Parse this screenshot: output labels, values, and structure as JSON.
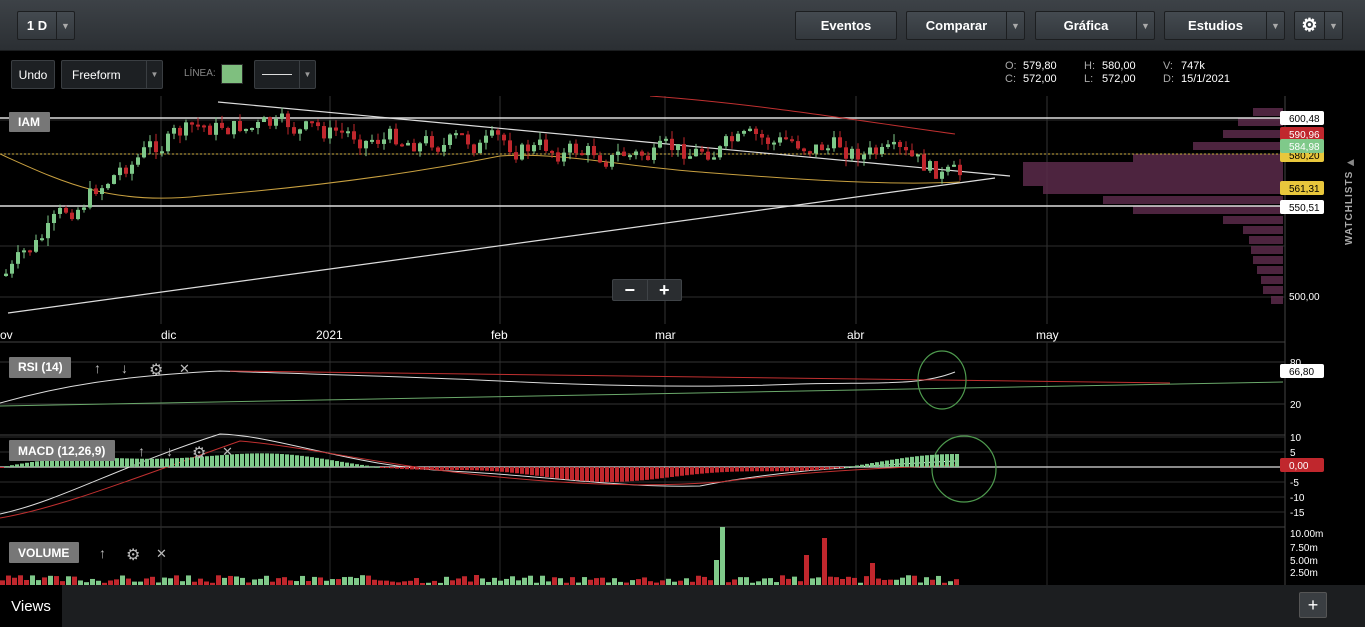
{
  "toolbar": {
    "interval": "1 D",
    "eventos": "Eventos",
    "comparar": "Comparar",
    "grafica": "Gráfica",
    "estudios": "Estudios"
  },
  "subbar": {
    "undo": "Undo",
    "draw_mode": "Freeform",
    "linea_label": "LÍNEA:",
    "line_color": "#7fbf7f"
  },
  "ohlc": {
    "o_label": "O:",
    "o": "579,80",
    "c_label": "C:",
    "c": "572,00",
    "h_label": "H:",
    "h": "580,00",
    "l_label": "L:",
    "l": "572,00",
    "v_label": "V:",
    "v": "747k",
    "d_label": "D:",
    "d": "15/1/2021"
  },
  "main_chart": {
    "symbol": "IAM",
    "price_labels": {
      "top": "600,48",
      "red": "590,96",
      "current": "584,98",
      "hidden": "580,20",
      "yellow": "561,31",
      "support": "550,51",
      "bottom": "500,00"
    },
    "x_labels": [
      "ov",
      "dic",
      "2021",
      "feb",
      "mar",
      "abr",
      "may"
    ]
  },
  "rsi": {
    "label": "RSI (14)",
    "top": "80",
    "value": "66,80",
    "bottom": "20"
  },
  "macd": {
    "label": "MACD (12,26,9)",
    "ticks": [
      "10",
      "5",
      "-5",
      "-10",
      "-15"
    ],
    "value": "0,00"
  },
  "volume": {
    "label": "VOLUME",
    "ticks": [
      "10.00m",
      "7.50m",
      "5.00m",
      "2.50m"
    ]
  },
  "sidebar": {
    "watchlists": "WATCHLISTS"
  },
  "bottom": {
    "views": "Views",
    "add": "+"
  },
  "colors": {
    "up": "#7fc98a",
    "down": "#c0272d",
    "profile": "#5a2a4a"
  }
}
